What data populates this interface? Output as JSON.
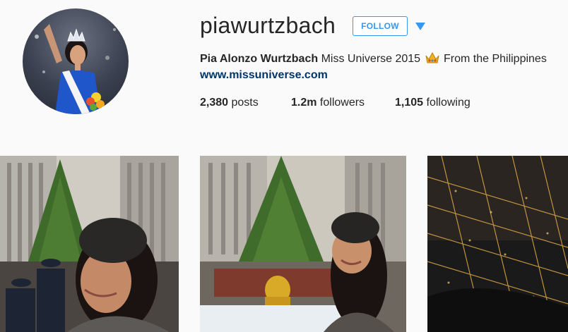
{
  "profile": {
    "username": "piawurtzbach",
    "follow_label": "FOLLOW",
    "full_name": "Pia Alonzo Wurtzbach",
    "bio_prefix": "Miss Universe 2015",
    "bio_suffix": "From the Philippines",
    "website": "www.missuniverse.com"
  },
  "stats": {
    "posts_count": "2,380",
    "posts_label": "posts",
    "followers_count": "1.2m",
    "followers_label": "followers",
    "following_count": "1,105",
    "following_label": "following"
  },
  "posts": [
    {
      "icon": "photo-christmas-tree-selfie"
    },
    {
      "icon": "photo-rockefeller-center-selfie"
    },
    {
      "icon": "photo-city-lights-aerial"
    }
  ],
  "colors": {
    "accent": "#3897f0",
    "link": "#003569",
    "background": "#fafafa"
  }
}
